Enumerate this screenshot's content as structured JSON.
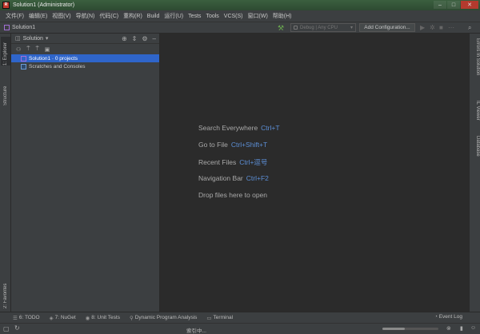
{
  "window": {
    "title": "Solution1 (Administrator)"
  },
  "menu": [
    "文件(F)",
    "编辑(E)",
    "视图(V)",
    "导航(N)",
    "代码(C)",
    "重构(R)",
    "Build",
    "运行(U)",
    "Tests",
    "Tools",
    "VCS(S)",
    "窗口(W)",
    "帮助(H)"
  ],
  "nav": {
    "breadcrumb": "Solution1",
    "config_select": "Debug | Any CPU",
    "add_config": "Add Configuration..."
  },
  "left_strip": {
    "explorer": "1: Explorer",
    "structure": "Structure",
    "favorites": "2: Favorites"
  },
  "right_strip": {
    "errors": "Errors In Solution",
    "il_viewer": "IL Viewer",
    "database": "Database"
  },
  "explorer": {
    "title": "Solution",
    "items": [
      {
        "label": "Solution1 · 0 projects",
        "selected": true
      },
      {
        "label": "Scratches and Consoles",
        "selected": false
      }
    ]
  },
  "editor_tips": [
    {
      "label": "Search Everywhere",
      "shortcut": "Ctrl+T"
    },
    {
      "label": "Go to File",
      "shortcut": "Ctrl+Shift+T"
    },
    {
      "label": "Recent Files",
      "shortcut": "Ctrl+逗号"
    },
    {
      "label": "Navigation Bar",
      "shortcut": "Ctrl+F2"
    },
    {
      "label": "Drop files here to open",
      "shortcut": ""
    }
  ],
  "bottom_tools": [
    {
      "label": "6: TODO"
    },
    {
      "label": "7: NuGet"
    },
    {
      "label": "8: Unit Tests"
    },
    {
      "label": "Dynamic Program Analysis"
    },
    {
      "label": "Terminal"
    }
  ],
  "event_log": "Event Log",
  "status": {
    "text": "索引中...",
    "progress": 0.4
  }
}
